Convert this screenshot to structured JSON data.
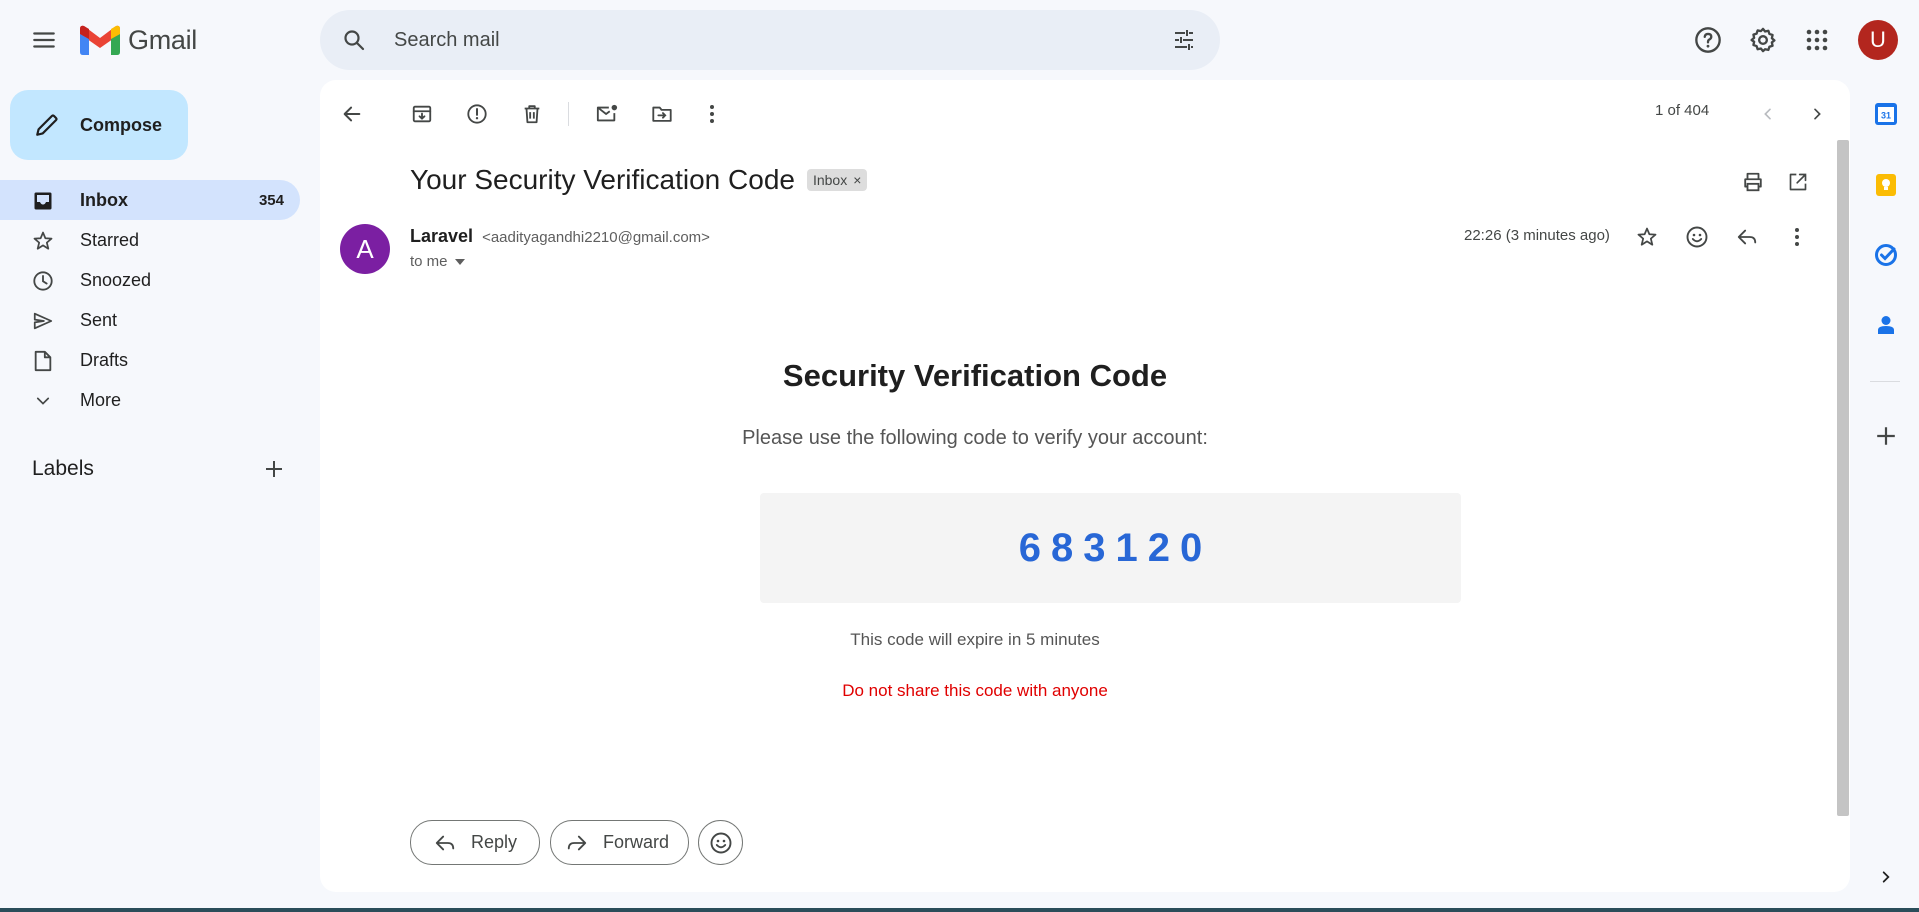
{
  "app": {
    "name": "Gmail"
  },
  "search": {
    "placeholder": "Search mail"
  },
  "account": {
    "avatar_letter": "U",
    "avatar_color": "#b3261e"
  },
  "compose": {
    "label": "Compose"
  },
  "nav": {
    "items": [
      {
        "label": "Inbox",
        "count": "354",
        "icon": "inbox-icon",
        "active": true
      },
      {
        "label": "Starred",
        "count": "",
        "icon": "star-icon",
        "active": false
      },
      {
        "label": "Snoozed",
        "count": "",
        "icon": "clock-icon",
        "active": false
      },
      {
        "label": "Sent",
        "count": "",
        "icon": "send-icon",
        "active": false
      },
      {
        "label": "Drafts",
        "count": "",
        "icon": "draft-icon",
        "active": false
      },
      {
        "label": "More",
        "count": "",
        "icon": "chevron-down-icon",
        "active": false
      }
    ],
    "labels_title": "Labels"
  },
  "toolbar": {
    "pager": "1 of 404"
  },
  "email": {
    "subject": "Your Security Verification Code",
    "label_badge": "Inbox",
    "sender_initial": "A",
    "sender_avatar_color": "#7b1fa2",
    "sender_name": "Laravel",
    "sender_email": "<aadityagandhi2210@gmail.com>",
    "recipient": "to me",
    "time": "22:26 (3 minutes ago)",
    "body": {
      "title": "Security Verification Code",
      "subtitle": "Please use the following code to verify your account:",
      "code": "683120",
      "code_color": "#2867d6",
      "expiry": "This code will expire in 5 minutes",
      "warning": "Do not share this code with anyone",
      "warning_color": "#e00000"
    }
  },
  "actions": {
    "reply": "Reply",
    "forward": "Forward"
  }
}
